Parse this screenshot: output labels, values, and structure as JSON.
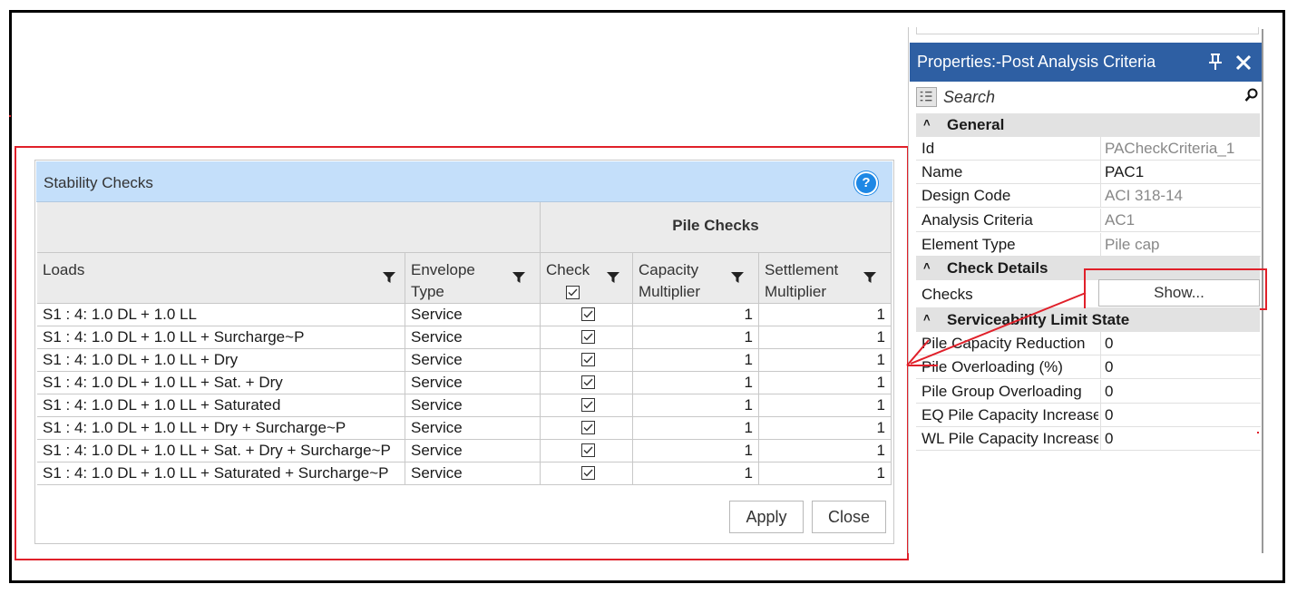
{
  "dialog": {
    "title": "Stability Checks",
    "help_icon": "?",
    "group_header": "Pile Checks",
    "columns": {
      "loads": "Loads",
      "envelope_type": "Envelope Type",
      "check": "Check",
      "capacity_multiplier": "Capacity Multiplier",
      "settlement_multiplier": "Settlement Multiplier"
    },
    "rows": [
      {
        "load": "S1 : 4: 1.0 DL + 1.0 LL",
        "envelope": "Service",
        "check": true,
        "capacity": "1",
        "settlement": "1"
      },
      {
        "load": "S1 : 4: 1.0 DL + 1.0 LL + Surcharge~P",
        "envelope": "Service",
        "check": true,
        "capacity": "1",
        "settlement": "1"
      },
      {
        "load": "S1 : 4: 1.0 DL + 1.0 LL + Dry",
        "envelope": "Service",
        "check": true,
        "capacity": "1",
        "settlement": "1"
      },
      {
        "load": "S1 : 4: 1.0 DL + 1.0 LL + Sat. + Dry",
        "envelope": "Service",
        "check": true,
        "capacity": "1",
        "settlement": "1"
      },
      {
        "load": "S1 : 4: 1.0 DL + 1.0 LL + Saturated",
        "envelope": "Service",
        "check": true,
        "capacity": "1",
        "settlement": "1"
      },
      {
        "load": "S1 : 4: 1.0 DL + 1.0 LL + Dry + Surcharge~P",
        "envelope": "Service",
        "check": true,
        "capacity": "1",
        "settlement": "1"
      },
      {
        "load": "S1 : 4: 1.0 DL + 1.0 LL + Sat. + Dry + Surcharge~P",
        "envelope": "Service",
        "check": true,
        "capacity": "1",
        "settlement": "1"
      },
      {
        "load": "S1 : 4: 1.0 DL + 1.0 LL + Saturated + Surcharge~P",
        "envelope": "Service",
        "check": true,
        "capacity": "1",
        "settlement": "1"
      }
    ],
    "apply_label": "Apply",
    "close_label": "Close"
  },
  "properties": {
    "title": "Properties:-Post Analysis Criteria",
    "search_placeholder": "Search",
    "categories": {
      "general": "General",
      "check_details": "Check Details",
      "serviceability": "Serviceability Limit State"
    },
    "general": [
      {
        "key": "Id",
        "value": "PACheckCriteria_1",
        "readonly": true
      },
      {
        "key": "Name",
        "value": "PAC1",
        "readonly": false
      },
      {
        "key": "Design Code",
        "value": "ACI 318-14",
        "readonly": true
      },
      {
        "key": "Analysis Criteria",
        "value": "AC1",
        "readonly": true
      },
      {
        "key": "Element Type",
        "value": "Pile cap",
        "readonly": true
      }
    ],
    "checks_key": "Checks",
    "checks_button": "Show...",
    "serviceability": [
      {
        "key": "Pile Capacity Reduction",
        "value": "0"
      },
      {
        "key": "Pile Overloading (%)",
        "value": "0"
      },
      {
        "key": "Pile Group Overloading",
        "value": "0"
      },
      {
        "key": "EQ Pile Capacity Increase",
        "value": "0"
      },
      {
        "key": "WL Pile Capacity Increase",
        "value": "0"
      }
    ]
  },
  "colors": {
    "annotation_red": "#e0202a",
    "panel_header": "#2e5fa3",
    "dialog_title_bg": "#c4dffa"
  }
}
